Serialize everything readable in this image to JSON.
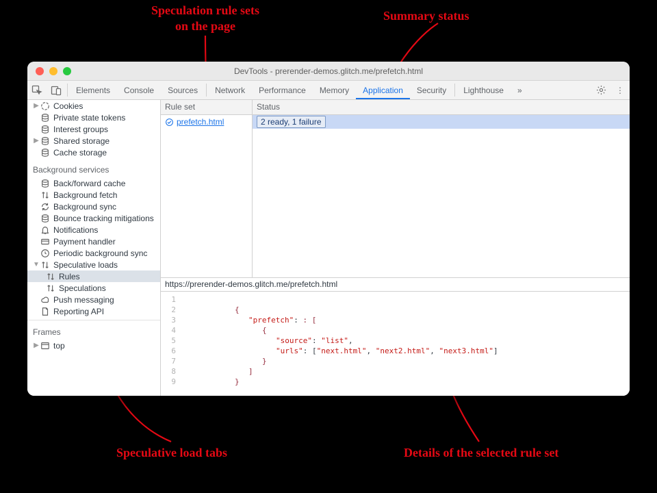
{
  "annotations": {
    "rulesets": "Speculation rule sets\non the page",
    "summary": "Summary status",
    "tabs": "Speculative load tabs",
    "details": "Details of the selected rule set"
  },
  "window": {
    "title": "DevTools - prerender-demos.glitch.me/prefetch.html"
  },
  "topTabs": {
    "elements": "Elements",
    "console": "Console",
    "sources": "Sources",
    "network": "Network",
    "performance": "Performance",
    "memory": "Memory",
    "application": "Application",
    "security": "Security",
    "lighthouse": "Lighthouse"
  },
  "sidebar": {
    "cookies": "Cookies",
    "privateState": "Private state tokens",
    "interestGroups": "Interest groups",
    "sharedStorage": "Shared storage",
    "cacheStorage": "Cache storage",
    "bgHeader": "Background services",
    "backForward": "Back/forward cache",
    "bgFetch": "Background fetch",
    "bgSync": "Background sync",
    "bounce": "Bounce tracking mitigations",
    "notifications": "Notifications",
    "payment": "Payment handler",
    "periodic": "Periodic background sync",
    "speculative": "Speculative loads",
    "rules": "Rules",
    "speculations": "Speculations",
    "push": "Push messaging",
    "reporting": "Reporting API",
    "framesHeader": "Frames",
    "top": "top"
  },
  "table": {
    "col1": "Rule set",
    "col2": "Status",
    "row1_ruleset": "prefetch.html",
    "row1_status": "2 ready, 1 failure"
  },
  "detail": {
    "url": "https://prerender-demos.glitch.me/prefetch.html"
  },
  "code": {
    "l1": "",
    "l2_brace": "{",
    "l3_key": "\"prefetch\"",
    "l3_rest": ": [",
    "l4": "{",
    "l5_key": "\"source\"",
    "l5_val": "\"list\"",
    "l6_key": "\"urls\"",
    "l6_v1": "\"next.html\"",
    "l6_v2": "\"next2.html\"",
    "l6_v3": "\"next3.html\"",
    "l7": "}",
    "l8": "]",
    "l9": "}"
  }
}
